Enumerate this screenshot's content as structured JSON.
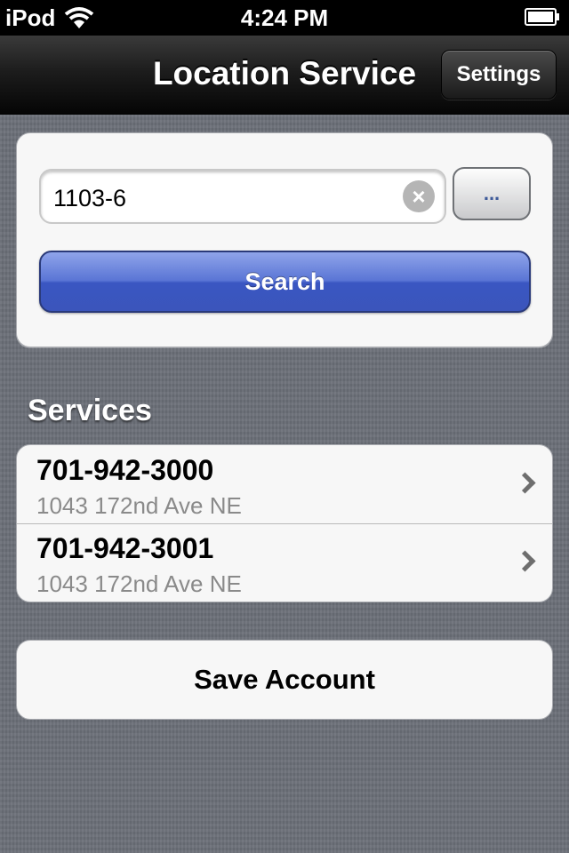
{
  "status_bar": {
    "carrier": "iPod",
    "time": "4:24 PM",
    "icons": [
      "wifi-icon",
      "battery-icon"
    ]
  },
  "nav_bar": {
    "title": "Location Service",
    "settings_label": "Settings"
  },
  "search": {
    "value": "1103-6",
    "clear_icon": "close-circle-icon",
    "more_label": "...",
    "button_label": "Search"
  },
  "services": {
    "header": "Services",
    "items": [
      {
        "phone": "701-942-3000",
        "address": "1043 172nd Ave NE"
      },
      {
        "phone": "701-942-3001",
        "address": "1043 172nd Ave NE"
      }
    ]
  },
  "save_button": {
    "label": "Save Account"
  },
  "colors": {
    "search_button": "#4f6bcf",
    "background": "#6b6f78",
    "navbar": "#1d1d1d"
  }
}
